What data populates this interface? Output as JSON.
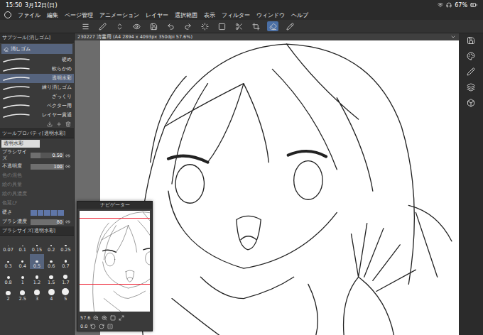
{
  "status_bar": {
    "time": "15:50",
    "date": "3月12日(日)",
    "battery": "67%"
  },
  "menu": [
    "ファイル",
    "編集",
    "ページ管理",
    "アニメーション",
    "レイヤー",
    "選択範囲",
    "表示",
    "フィルター",
    "ウィンドウ",
    "ヘルプ"
  ],
  "canvas_tab": {
    "title": "230227 清書用 (A4 2894 x 4093px 350dpi 57.6%)"
  },
  "subtool_panel": {
    "title": "サブツール[消しゴム]",
    "group": "消しゴム",
    "items": [
      {
        "label": "硬め",
        "selected": false
      },
      {
        "label": "軟らかめ",
        "selected": false
      },
      {
        "label": "透明水彩",
        "selected": true
      },
      {
        "label": "練り消しゴム",
        "selected": false
      },
      {
        "label": "ざっくり",
        "selected": false
      },
      {
        "label": "ベクター用",
        "selected": false
      },
      {
        "label": "レイヤー貫通",
        "selected": false
      }
    ]
  },
  "tool_property": {
    "title": "ツールプロパティ[透明水彩]",
    "preset": "透明水彩",
    "rows": [
      {
        "label": "ブラシサイズ",
        "kind": "slider",
        "value": "0.50",
        "level": 0.3,
        "disabled": false
      },
      {
        "label": "不透明度",
        "kind": "slider",
        "value": "100",
        "level": 1,
        "disabled": false
      },
      {
        "label": "色の混色",
        "kind": "plain",
        "disabled": true
      },
      {
        "label": "絵の具量",
        "kind": "plain",
        "disabled": true
      },
      {
        "label": "絵の具濃度",
        "kind": "plain",
        "disabled": true
      },
      {
        "label": "色延び",
        "kind": "plain",
        "disabled": true
      },
      {
        "label": "硬さ",
        "kind": "segments",
        "segments": 5,
        "level": 1,
        "disabled": false
      },
      {
        "label": "ブラシ濃度",
        "kind": "slider",
        "value": "80",
        "level": 0.8,
        "disabled": false
      }
    ]
  },
  "brush_size_panel": {
    "title": "ブラシサイズ[透明水彩]",
    "sizes": [
      {
        "label": "0.07",
        "selected": false
      },
      {
        "label": "0.1",
        "selected": false
      },
      {
        "label": "0.15",
        "selected": false
      },
      {
        "label": "0.2",
        "selected": false
      },
      {
        "label": "0.25",
        "selected": false
      },
      {
        "label": "0.3",
        "selected": false
      },
      {
        "label": "0.4",
        "selected": false
      },
      {
        "label": "0.5",
        "selected": true
      },
      {
        "label": "0.6",
        "selected": false
      },
      {
        "label": "0.7",
        "selected": false
      },
      {
        "label": "0.8",
        "selected": false
      },
      {
        "label": "1",
        "selected": false
      },
      {
        "label": "1.2",
        "selected": false
      },
      {
        "label": "1.5",
        "selected": false
      },
      {
        "label": "1.7",
        "selected": false
      },
      {
        "label": "2",
        "selected": false
      },
      {
        "label": "2.5",
        "selected": false
      },
      {
        "label": "3",
        "selected": false
      },
      {
        "label": "4",
        "selected": false
      },
      {
        "label": "5",
        "selected": false
      }
    ]
  },
  "navigator": {
    "title": "ナビゲーター",
    "zoom": "57.6",
    "angle": "0.0"
  }
}
